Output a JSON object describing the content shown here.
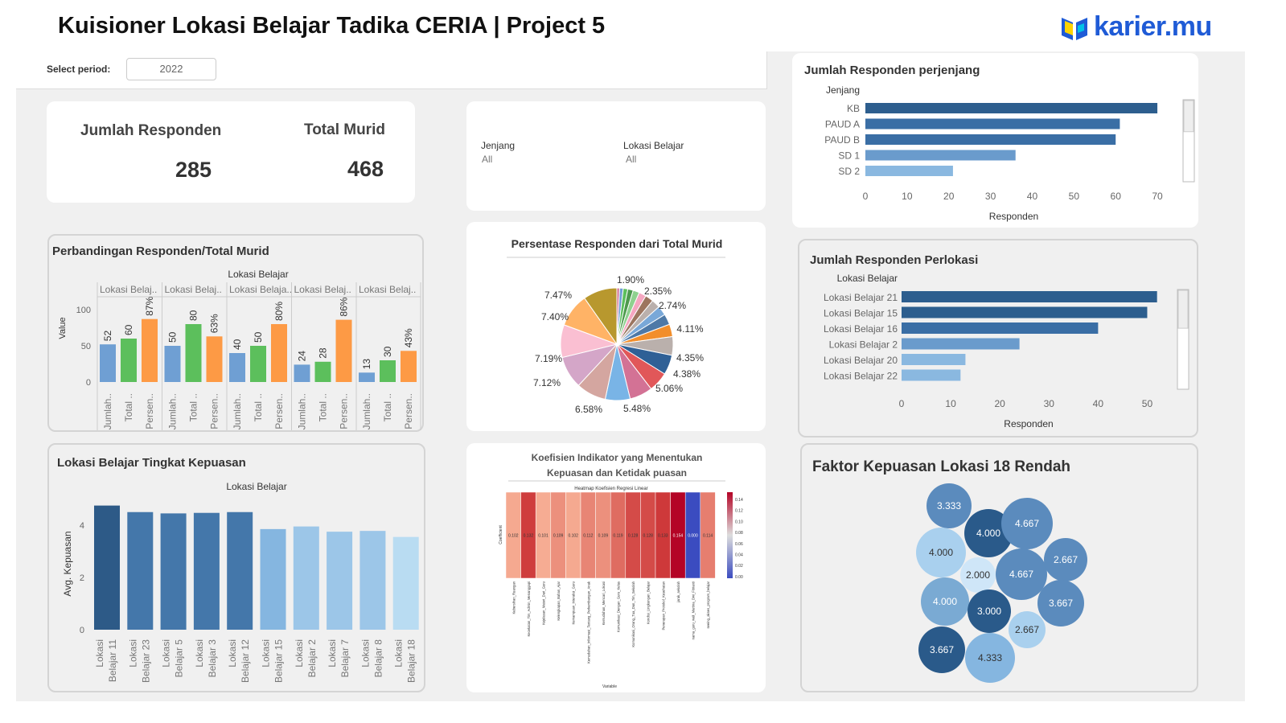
{
  "header": {
    "title": "Kuisioner Lokasi Belajar Tadika CERIA | Project 5",
    "brand": "karier.mu",
    "brand_color": "#1f5bd6"
  },
  "filter": {
    "label": "Select period:",
    "value": "2022"
  },
  "kpi": {
    "responden_label": "Jumlah Responden",
    "responden_value": "285",
    "murid_label": "Total Murid",
    "murid_value": "468"
  },
  "filters2": {
    "jenjang_label": "Jenjang",
    "jenjang_value": "All",
    "lokasi_label": "Lokasi Belajar",
    "lokasi_value": "All"
  },
  "chart_data": [
    {
      "id": "perjenjang",
      "type": "bar",
      "orientation": "horizontal",
      "title": "Jumlah Responden perjenjang",
      "ylabel": "Jenjang",
      "xlabel": "Responden",
      "categories": [
        "KB",
        "PAUD A",
        "PAUD B",
        "SD 1",
        "SD 2"
      ],
      "values": [
        70,
        61,
        60,
        36,
        21
      ],
      "xticks": [
        0,
        10,
        20,
        30,
        40,
        50,
        60,
        70
      ],
      "xlim": [
        0,
        75
      ],
      "colors": [
        "#2d5e8e",
        "#3a6ea5",
        "#3a6ea5",
        "#6a9bcc",
        "#8ab8e0"
      ]
    },
    {
      "id": "perlokasi",
      "type": "bar",
      "orientation": "horizontal",
      "title": "Jumlah Responden Perlokasi",
      "ylabel": "Lokasi Belajar",
      "xlabel": "Responden",
      "categories": [
        "Lokasi Belajar 21",
        "Lokasi Belajar 15",
        "Lokasi Belajar 16",
        "Lokasi Belajar 2",
        "Lokasi Belajar 20",
        "Lokasi Belajar 22"
      ],
      "values": [
        52,
        50,
        40,
        24,
        13,
        12
      ],
      "xticks": [
        0,
        10,
        20,
        30,
        40,
        50
      ],
      "xlim": [
        0,
        55
      ],
      "colors": [
        "#2d5e8e",
        "#2d5e8e",
        "#3a6ea5",
        "#6a9bcc",
        "#8ab8e0",
        "#8ab8e0"
      ]
    },
    {
      "id": "perbandingan",
      "type": "bar",
      "title": "Perbandingan Responden/Total Murid",
      "group_header": "Lokasi Belajar",
      "ylabel": "Value",
      "yticks": [
        0,
        50,
        100
      ],
      "ylim": [
        0,
        120
      ],
      "groups": [
        {
          "label": "Lokasi Belaj..",
          "values": [
            52,
            60,
            87
          ],
          "labels": [
            "52",
            "60",
            "87%"
          ]
        },
        {
          "label": "Lokasi Belaj..",
          "values": [
            50,
            80,
            63
          ],
          "labels": [
            "50",
            "80",
            "63%"
          ]
        },
        {
          "label": "Lokasi Belaja..",
          "values": [
            40,
            50,
            80
          ],
          "labels": [
            "40",
            "50",
            "80%"
          ]
        },
        {
          "label": "Lokasi Belaj..",
          "values": [
            24,
            28,
            86
          ],
          "labels": [
            "24",
            "28",
            "86%"
          ]
        },
        {
          "label": "Lokasi Belaj..",
          "values": [
            13,
            30,
            43
          ],
          "labels": [
            "13",
            "30",
            "43%"
          ]
        }
      ],
      "measures": [
        "Jumlah..",
        "Total ..",
        "Persen.."
      ],
      "colors": [
        "#6f9fd3",
        "#5cbf5c",
        "#fd9a45"
      ]
    },
    {
      "id": "pie",
      "type": "pie",
      "title": "Persentase Responden dari Total Murid",
      "labels": [
        "1.90%",
        "2.35%",
        "2.74%",
        "4.11%",
        "4.35%",
        "4.38%",
        "5.06%",
        "5.48%",
        "6.58%",
        "7.12%",
        "7.19%",
        "7.40%",
        "7.47%"
      ],
      "values": [
        0.6,
        0.8,
        1.0,
        1.2,
        1.4,
        1.6,
        1.8,
        1.9,
        2.1,
        2.35,
        2.74,
        4.11,
        4.35,
        4.38,
        5.06,
        5.48,
        6.58,
        7.12,
        7.19,
        7.4,
        7.47
      ],
      "colors": [
        "#d37295",
        "#6f9fd3",
        "#5cbf5c",
        "#4e9a4e",
        "#8fd18f",
        "#f5a6c0",
        "#9c755f",
        "#bab0ac",
        "#79a8d8",
        "#4e79a7",
        "#f28e2b",
        "#bab0ac",
        "#2f6096",
        "#e15759",
        "#d37295",
        "#79b4e6",
        "#d4a6a0",
        "#d4a6c8",
        "#fabfd2",
        "#ffb366",
        "#b8982e"
      ]
    },
    {
      "id": "kepuasan",
      "type": "bar",
      "title": "Lokasi Belajar Tingkat Kepuasan",
      "group_header": "Lokasi Belajar",
      "ylabel": "Avg. Kepuasan",
      "categories": [
        "Lokasi Belajar 11",
        "Lokasi Belajar 23",
        "Lokasi Belajar 5",
        "Lokasi Belajar 3",
        "Lokasi Belajar 12",
        "Lokasi Belajar 15",
        "Lokasi Belajar 2",
        "Lokasi Belajar 7",
        "Lokasi Belajar 8",
        "Lokasi Belajar 18"
      ],
      "values": [
        4.75,
        4.5,
        4.45,
        4.47,
        4.5,
        3.85,
        3.95,
        3.75,
        3.78,
        3.55
      ],
      "yticks": [
        0,
        2,
        4
      ],
      "ylim": [
        0,
        5
      ],
      "colors": [
        "#2d5a87",
        "#4477aa",
        "#4477aa",
        "#4477aa",
        "#4477aa",
        "#85b6e0",
        "#9cc6e8",
        "#9cc6e8",
        "#9cc6e8",
        "#b9dcf2"
      ]
    },
    {
      "id": "heatmap",
      "type": "heatmap",
      "title": "Koefisien Indikator yang Menentukan Kepuasan dan Ketidak puasan",
      "subtitle": "Heatmap Koefisien Regresi Linear",
      "ylabel": "Coefficient",
      "xlabel": "Variable",
      "values": [
        0.102,
        0.132,
        0.101,
        0.109,
        0.102,
        0.112,
        0.109,
        0.119,
        0.128,
        0.128,
        0.133,
        0.154,
        0.0,
        0.114
      ],
      "labels": [
        "0.102",
        "0.132",
        "0.101",
        "0.109",
        "0.102",
        "0.112",
        "0.109",
        "0.119",
        "0.128",
        "0.128",
        "0.133",
        "0.154",
        "0.000",
        "0.114"
      ],
      "variables": [
        "Kebersihan_Ruangan",
        "Kecekatan_Tim_Admin_Menanggapi",
        "Kejelasan_Materi_Dari_Guru",
        "Kelengkapan_Bahan_Ajar",
        "Kemampuan_Interaksi_Guru",
        "Kemudahan_Informasi_Tentang_Perkembangan_Anak",
        "Kemudahan_Mencari_Lokasi",
        "Komunikasi_Dengan_Guru_Kelas",
        "Komunikasi_Orang_Tua_Dan_Tim_Sekolah",
        "Kondisi_Lingkungan_Belajar",
        "Penerapan_Protokol_Kesehatan",
        "jarak_sekolah",
        "nama_guru_wali_Martina_Dwi_Fitrianti",
        "seeing_akses_program_belajar"
      ],
      "colorbar_ticks": [
        "0.14",
        "0.12",
        "0.10",
        "0.08",
        "0.06",
        "0.04",
        "0.02",
        "0.00"
      ]
    },
    {
      "id": "bubbles",
      "type": "bubble",
      "title": "Faktor Kepuasan Lokasi 18 Rendah",
      "values": [
        3.333,
        4.0,
        4.667,
        4.0,
        2.0,
        4.667,
        2.667,
        4.0,
        3.0,
        3.667,
        2.667,
        3.667,
        4.333
      ],
      "labels": [
        "3.333",
        "4.000",
        "4.667",
        "4.000",
        "2.000",
        "4.667",
        "2.667",
        "4.000",
        "3.000",
        "3.667",
        "2.667",
        "3.667",
        "4.333"
      ],
      "colors": [
        "#5b8bbd",
        "#2a5a8a",
        "#5b8bbd",
        "#a9d0ee",
        "#cfe6f8",
        "#5b8bbd",
        "#5b8bbd",
        "#7aaad3",
        "#2a5a8a",
        "#5b8bbd",
        "#a9d0ee",
        "#2a5a8a",
        "#85b6e0"
      ]
    }
  ]
}
